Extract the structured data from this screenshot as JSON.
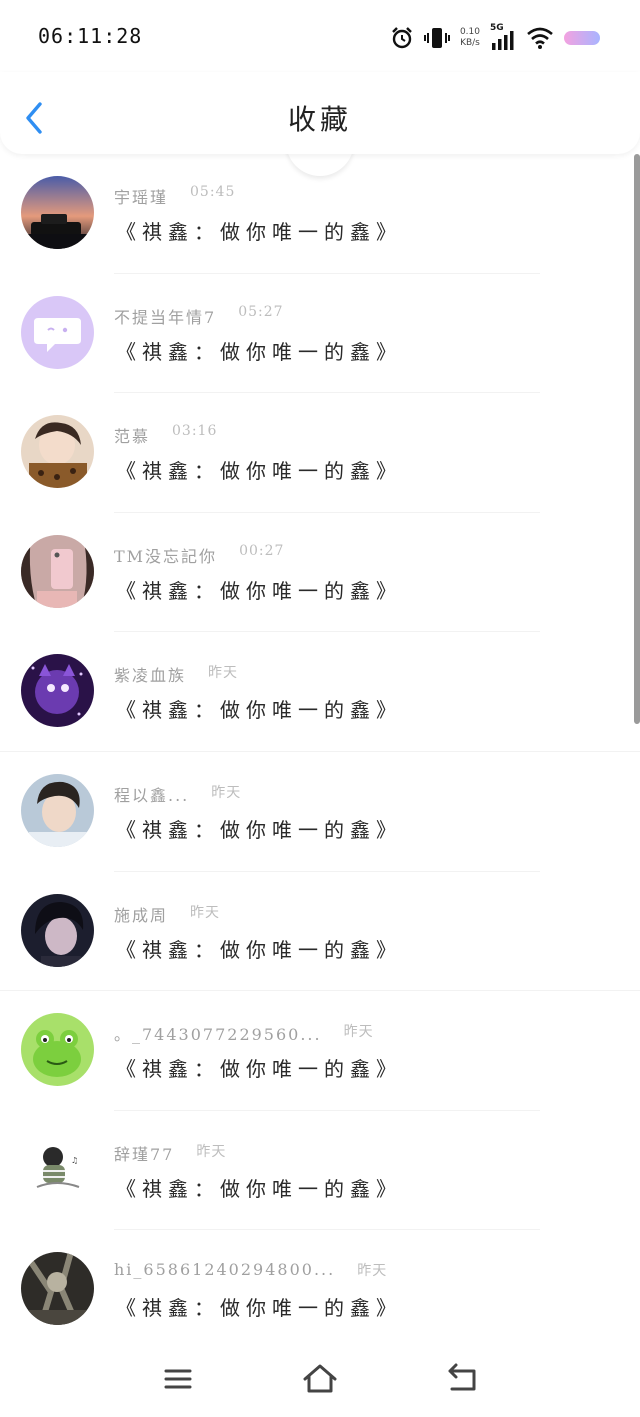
{
  "status_bar": {
    "time": "06:11:28",
    "net_speed_value": "0.10",
    "net_speed_unit": "KB/s",
    "signal_label": "5G"
  },
  "header": {
    "title": "收藏"
  },
  "messages": [
    {
      "name": "宇瑶瑾",
      "time": "05:45",
      "text": "《祺鑫：做你唯一的鑫》"
    },
    {
      "name": "不提当年情7",
      "time": "05:27",
      "text": "《祺鑫：做你唯一的鑫》"
    },
    {
      "name": "范慕",
      "time": "03:16",
      "text": "《祺鑫：做你唯一的鑫》"
    },
    {
      "name": "TM没忘記你",
      "time": "00:27",
      "text": "《祺鑫：做你唯一的鑫》"
    },
    {
      "name": "紫凌血族",
      "time": "昨天",
      "text": "《祺鑫：做你唯一的鑫》"
    },
    {
      "name": "程以鑫...",
      "time": "昨天",
      "text": "《祺鑫：做你唯一的鑫》"
    },
    {
      "name": "施成周",
      "time": "昨天",
      "text": "《祺鑫：做你唯一的鑫》"
    },
    {
      "name": "。_7443077229560...",
      "time": "昨天",
      "text": "《祺鑫：做你唯一的鑫》"
    },
    {
      "name": "辞瑾77",
      "time": "昨天",
      "text": "《祺鑫：做你唯一的鑫》"
    },
    {
      "name": "hi_65861240294800...",
      "time": "昨天",
      "text": "《祺鑫：做你唯一的鑫》"
    }
  ],
  "icons": {
    "back": "chevron-left-icon",
    "menu": "menu-icon",
    "home": "home-icon",
    "return": "return-icon"
  },
  "colors": {
    "accent": "#2f8ef2",
    "battery_start": "#f3a2e0",
    "battery_end": "#a8b4ff"
  }
}
